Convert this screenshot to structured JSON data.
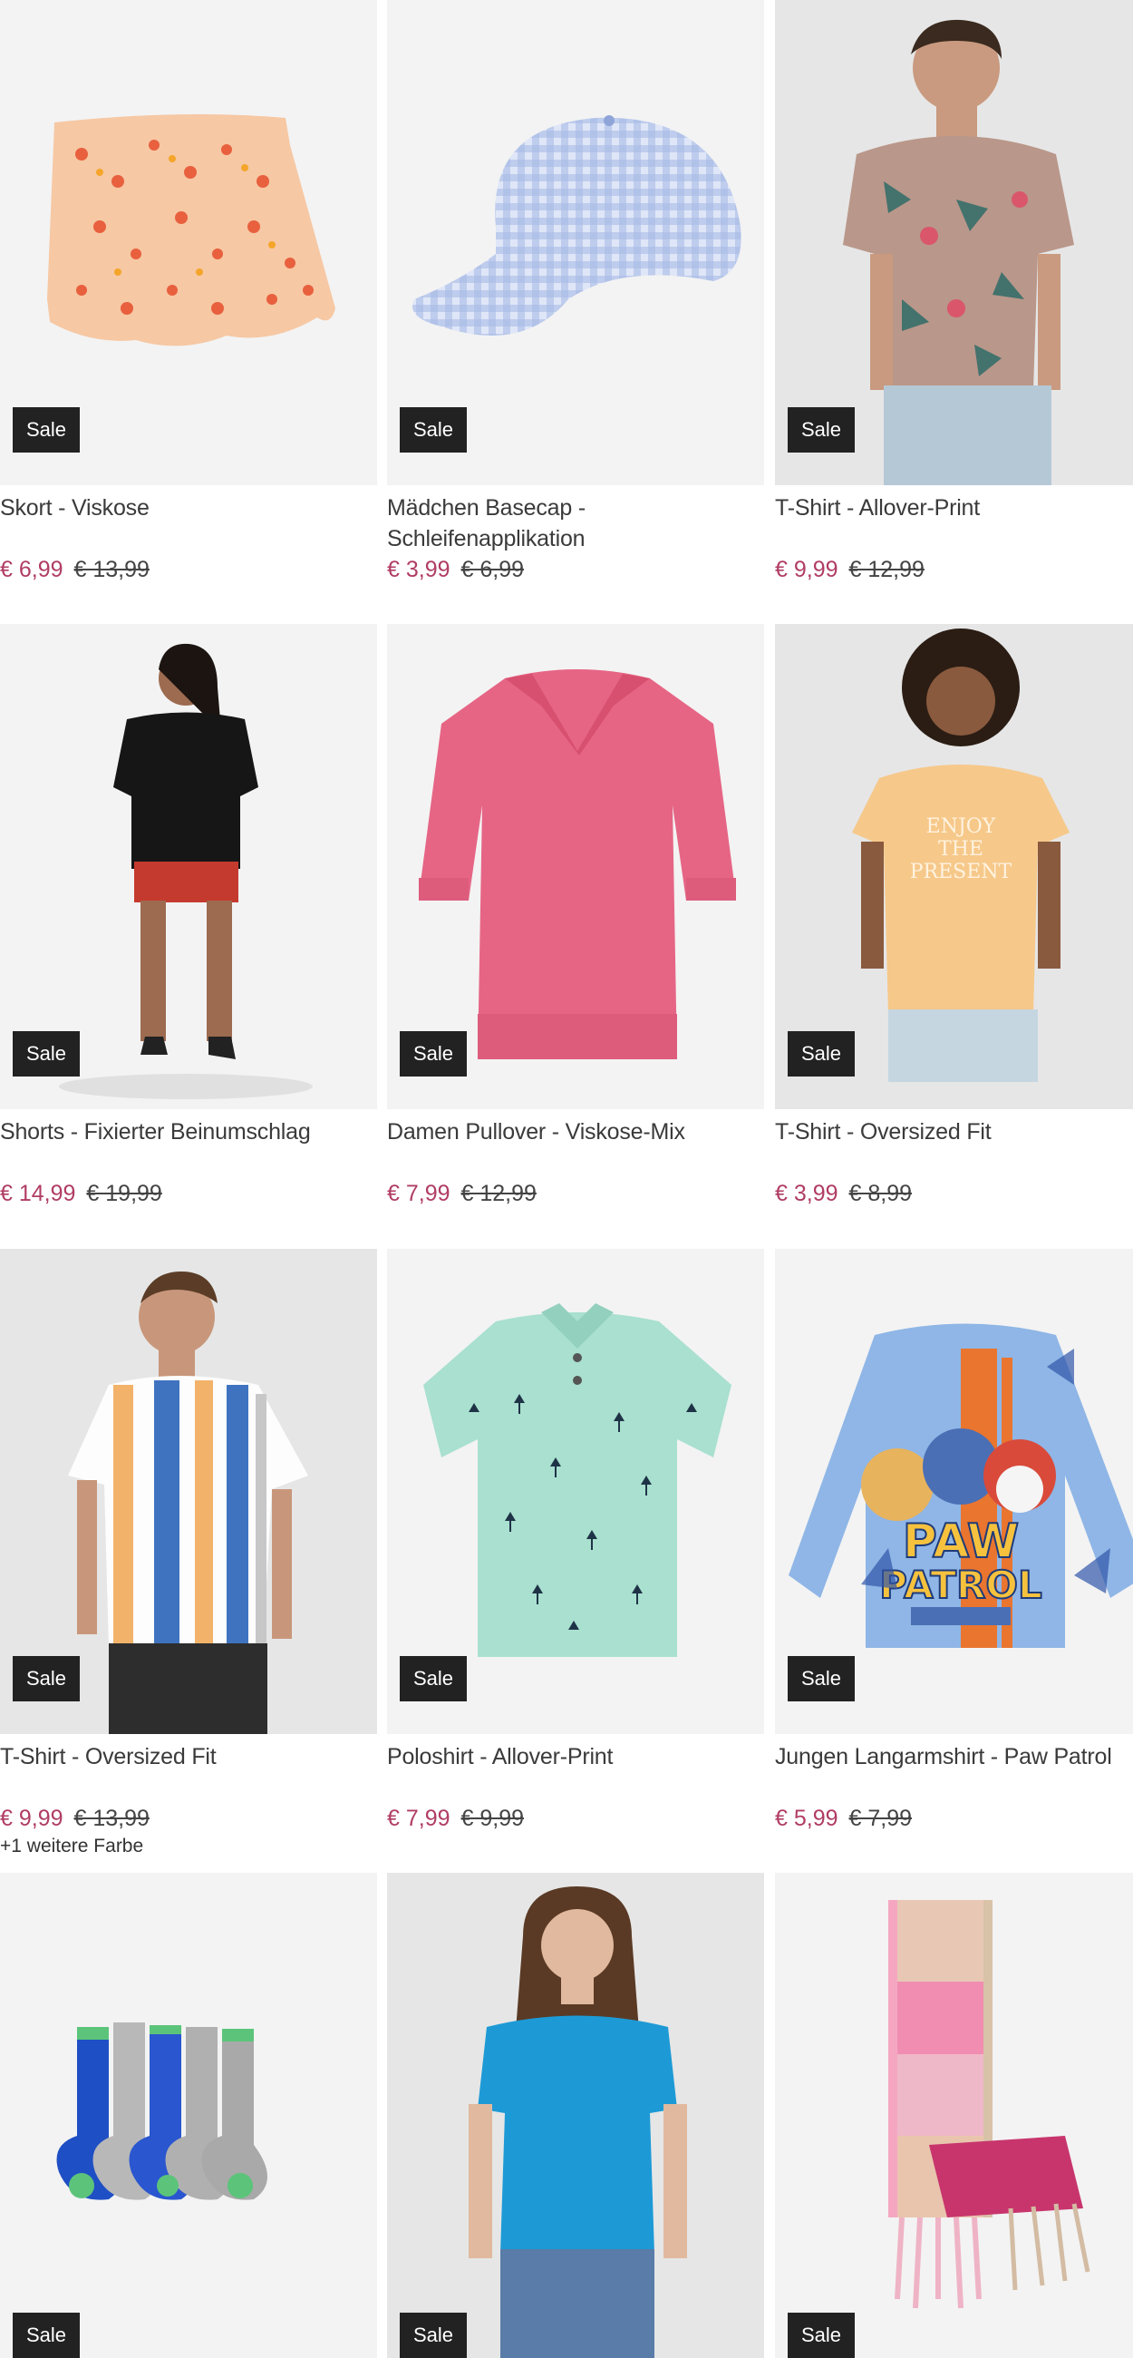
{
  "sale_label": "Sale",
  "colors": {
    "price_new": "#b03d63",
    "badge_bg": "#222222"
  },
  "products": [
    {
      "name": "Skort - Viskose",
      "price": "€ 6,99",
      "old_price": "€ 13,99",
      "image": "floral-skort"
    },
    {
      "name": "Mädchen Basecap - Schleifenapplikation",
      "price": "€ 3,99",
      "old_price": "€ 6,99",
      "image": "gingham-cap"
    },
    {
      "name": "T-Shirt - Allover-Print",
      "price": "€ 9,99",
      "old_price": "€ 12,99",
      "image": "man-floral-tshirt"
    },
    {
      "name": "Shorts - Fixierter Beinumschlag",
      "price": "€ 14,99",
      "old_price": "€ 19,99",
      "image": "woman-black-top-red-shorts"
    },
    {
      "name": "Damen Pullover - Viskose-Mix",
      "price": "€ 7,99",
      "old_price": "€ 12,99",
      "image": "pink-pullover"
    },
    {
      "name": "T-Shirt - Oversized Fit",
      "price": "€ 3,99",
      "old_price": "€ 8,99",
      "image": "woman-orange-tshirt"
    },
    {
      "name": "T-Shirt - Oversized Fit",
      "price": "€ 9,99",
      "old_price": "€ 13,99",
      "extra": "+1 weitere Farbe",
      "image": "man-striped-tshirt"
    },
    {
      "name": "Poloshirt - Allover-Print",
      "price": "€ 7,99",
      "old_price": "€ 9,99",
      "image": "mint-poloshirt"
    },
    {
      "name": "Jungen Langarmshirt - Paw Patrol",
      "price": "€ 5,99",
      "old_price": "€ 7,99",
      "image": "paw-patrol-longsleeve"
    },
    {
      "name": "",
      "price": "",
      "old_price": "",
      "image": "socks-pack"
    },
    {
      "name": "",
      "price": "",
      "old_price": "",
      "image": "woman-blue-tshirt"
    },
    {
      "name": "",
      "price": "",
      "old_price": "",
      "image": "checked-scarf"
    }
  ]
}
